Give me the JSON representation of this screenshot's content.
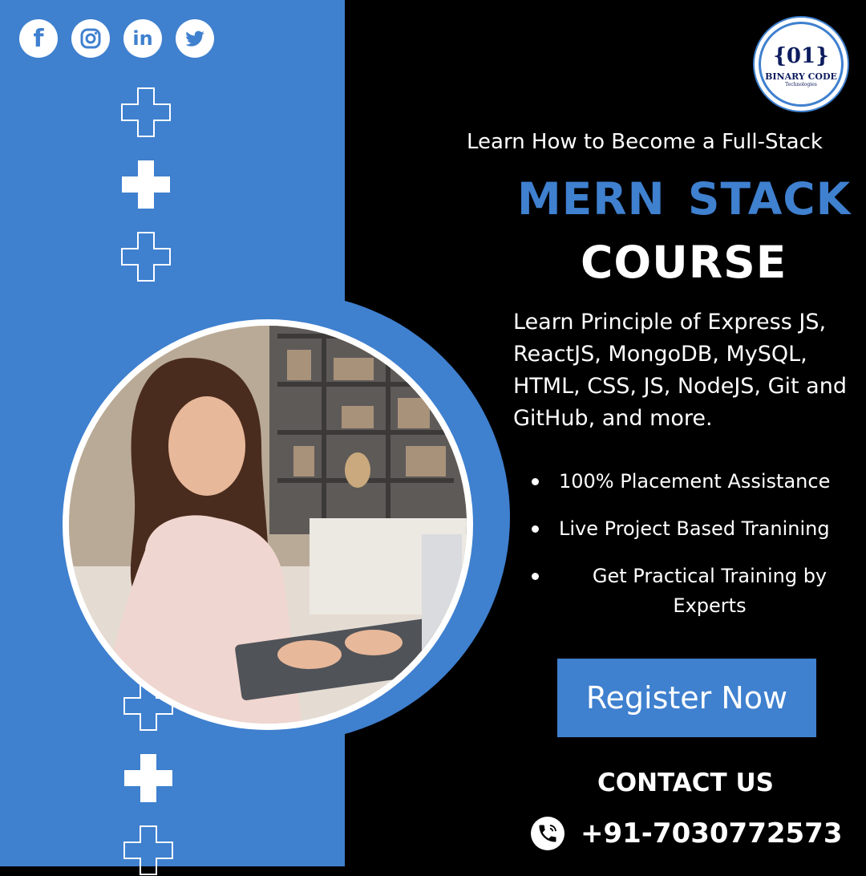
{
  "brand": {
    "logo_mark": "{01}",
    "name": "BINARY CODE",
    "tagline": "Technologies",
    "accent_color": "#3f80cf",
    "logo_text_color": "#0d1c5e"
  },
  "social_icons": [
    "facebook-icon",
    "instagram-icon",
    "linkedin-icon",
    "twitter-icon"
  ],
  "social_labels": {
    "facebook": "f",
    "linkedin": "in"
  },
  "headline": {
    "subtitle": "Learn How to Become a Full-Stack",
    "title_line1": "MERN  STACK",
    "title_line2": "COURSE"
  },
  "description": "Learn Principle of Express JS, ReactJS, MongoDB, MySQL, HTML, CSS, JS, NodeJS, Git and GitHub, and more.",
  "features": [
    "100% Placement Assistance",
    "Live Project Based Tranining",
    "Get Practical Training by Experts"
  ],
  "cta": {
    "label": "Register Now"
  },
  "contact": {
    "title": "CONTACT US",
    "phone": "+91-7030772573",
    "icon": "phone-icon"
  },
  "decorations": {
    "cross_icon": "plus-cross-icon",
    "photo": "woman-using-laptop-photo"
  }
}
